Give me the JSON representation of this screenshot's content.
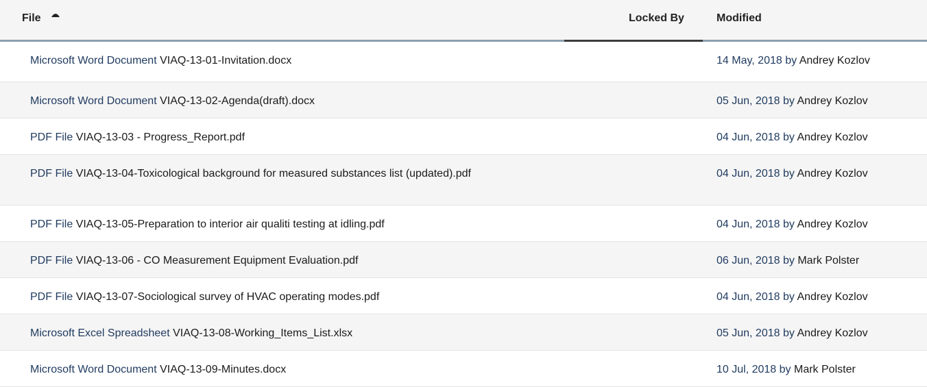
{
  "header": {
    "file_label": "File",
    "locked_by_label": "Locked By",
    "modified_label": "Modified"
  },
  "rows": [
    {
      "type": "Microsoft Word Document",
      "name": "VIAQ-13-01-Invitation.docx",
      "date": "14 May, 2018",
      "by": "by",
      "author": "Andrey Kozlov"
    },
    {
      "type": "Microsoft Word Document",
      "name": "VIAQ-13-02-Agenda(draft).docx",
      "date": "05 Jun, 2018",
      "by": "by",
      "author": "Andrey Kozlov"
    },
    {
      "type": "PDF File",
      "name": "VIAQ-13-03 - Progress_Report.pdf",
      "date": "04 Jun, 2018",
      "by": "by",
      "author": "Andrey Kozlov"
    },
    {
      "type": "PDF File",
      "name": "VIAQ-13-04-Toxicological background for measured substances list (updated).pdf",
      "date": "04 Jun, 2018",
      "by": "by",
      "author": "Andrey Kozlov"
    },
    {
      "type": "PDF File",
      "name": "VIAQ-13-05-Preparation to interior air qualiti testing at idling.pdf",
      "date": "04 Jun, 2018",
      "by": "by",
      "author": "Andrey Kozlov"
    },
    {
      "type": "PDF File",
      "name": "VIAQ-13-06 - CO Measurement Equipment Evaluation.pdf",
      "date": "06 Jun, 2018",
      "by": "by",
      "author": "Mark Polster"
    },
    {
      "type": "PDF File",
      "name": "VIAQ-13-07-Sociological survey of HVAC operating modes.pdf",
      "date": "04 Jun, 2018",
      "by": "by",
      "author": "Andrey Kozlov"
    },
    {
      "type": "Microsoft Excel Spreadsheet",
      "name": "VIAQ-13-08-Working_Items_List.xlsx",
      "date": "05 Jun, 2018",
      "by": "by",
      "author": "Andrey Kozlov"
    },
    {
      "type": "Microsoft Word Document",
      "name": "VIAQ-13-09-Minutes.docx",
      "date": "10 Jul, 2018",
      "by": "by",
      "author": "Mark Polster"
    }
  ]
}
